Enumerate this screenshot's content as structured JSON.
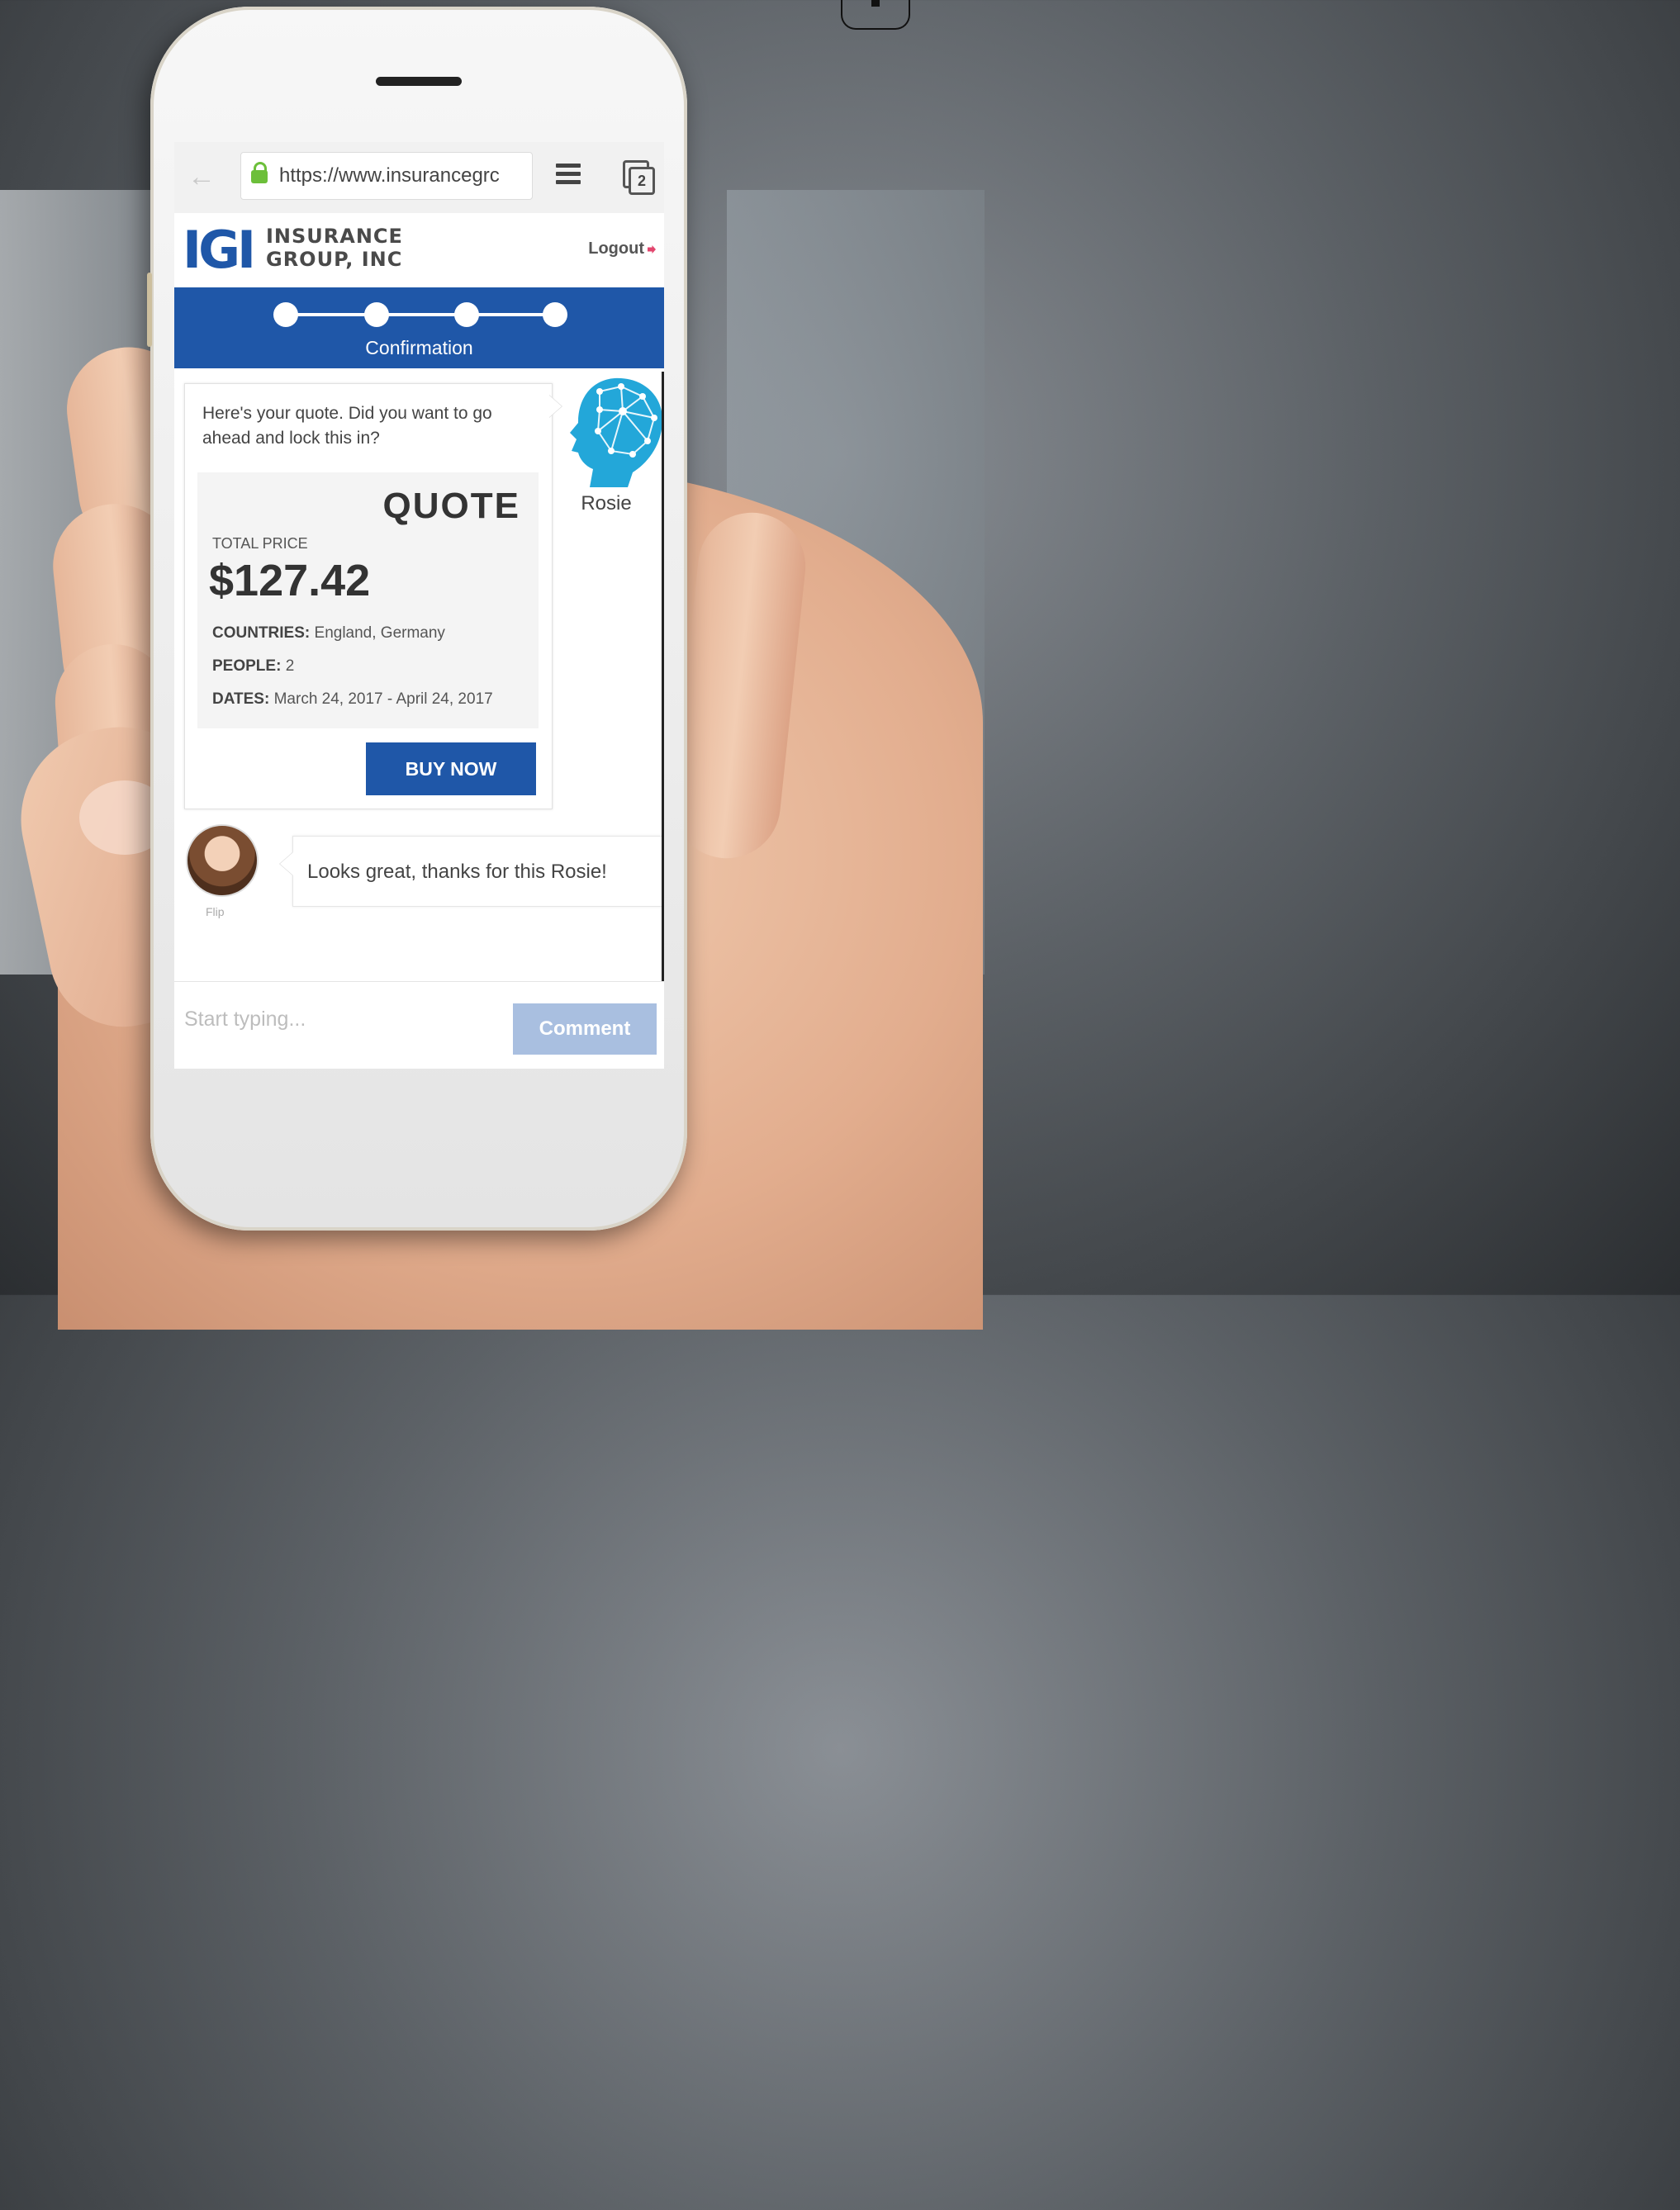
{
  "browser": {
    "url": "https://www.insurancegrc",
    "tab_count": "2"
  },
  "site": {
    "logo_mark": "IGI",
    "logo_line1": "INSURANCE",
    "logo_line2": "GROUP, INC",
    "logout_label": "Logout"
  },
  "progress": {
    "step_label": "Confirmation",
    "steps_total": 4,
    "current_step": 4
  },
  "bot": {
    "name": "Rosie",
    "message": "Here's your quote. Did you want to go ahead and lock this in?"
  },
  "quote": {
    "title": "QUOTE",
    "total_label": "TOTAL PRICE",
    "total_value": "$127.42",
    "countries_label": "COUNTRIES:",
    "countries_value": "England, Germany",
    "people_label": "PEOPLE:",
    "people_value": "2",
    "dates_label": "DATES:",
    "dates_value": "March 24, 2017 - April 24, 2017",
    "buy_label": "BUY NOW"
  },
  "user": {
    "name": "Flip",
    "message": "Looks great, thanks for this Rosie!"
  },
  "composer": {
    "placeholder": "Start typing...",
    "button_label": "Comment"
  },
  "colors": {
    "brand_blue": "#1f57a8",
    "comment_button": "#a9bfe0",
    "lock_green": "#6cbf3a",
    "logout_icon": "#e2456d"
  }
}
